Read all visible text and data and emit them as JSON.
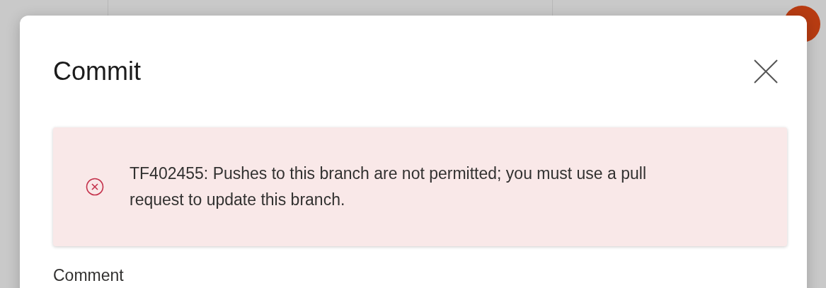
{
  "dialog": {
    "title": "Commit"
  },
  "error": {
    "message": "TF402455: Pushes to this branch are not permitted; you must use a pull request to update this branch."
  },
  "comment": {
    "label": "Comment"
  }
}
